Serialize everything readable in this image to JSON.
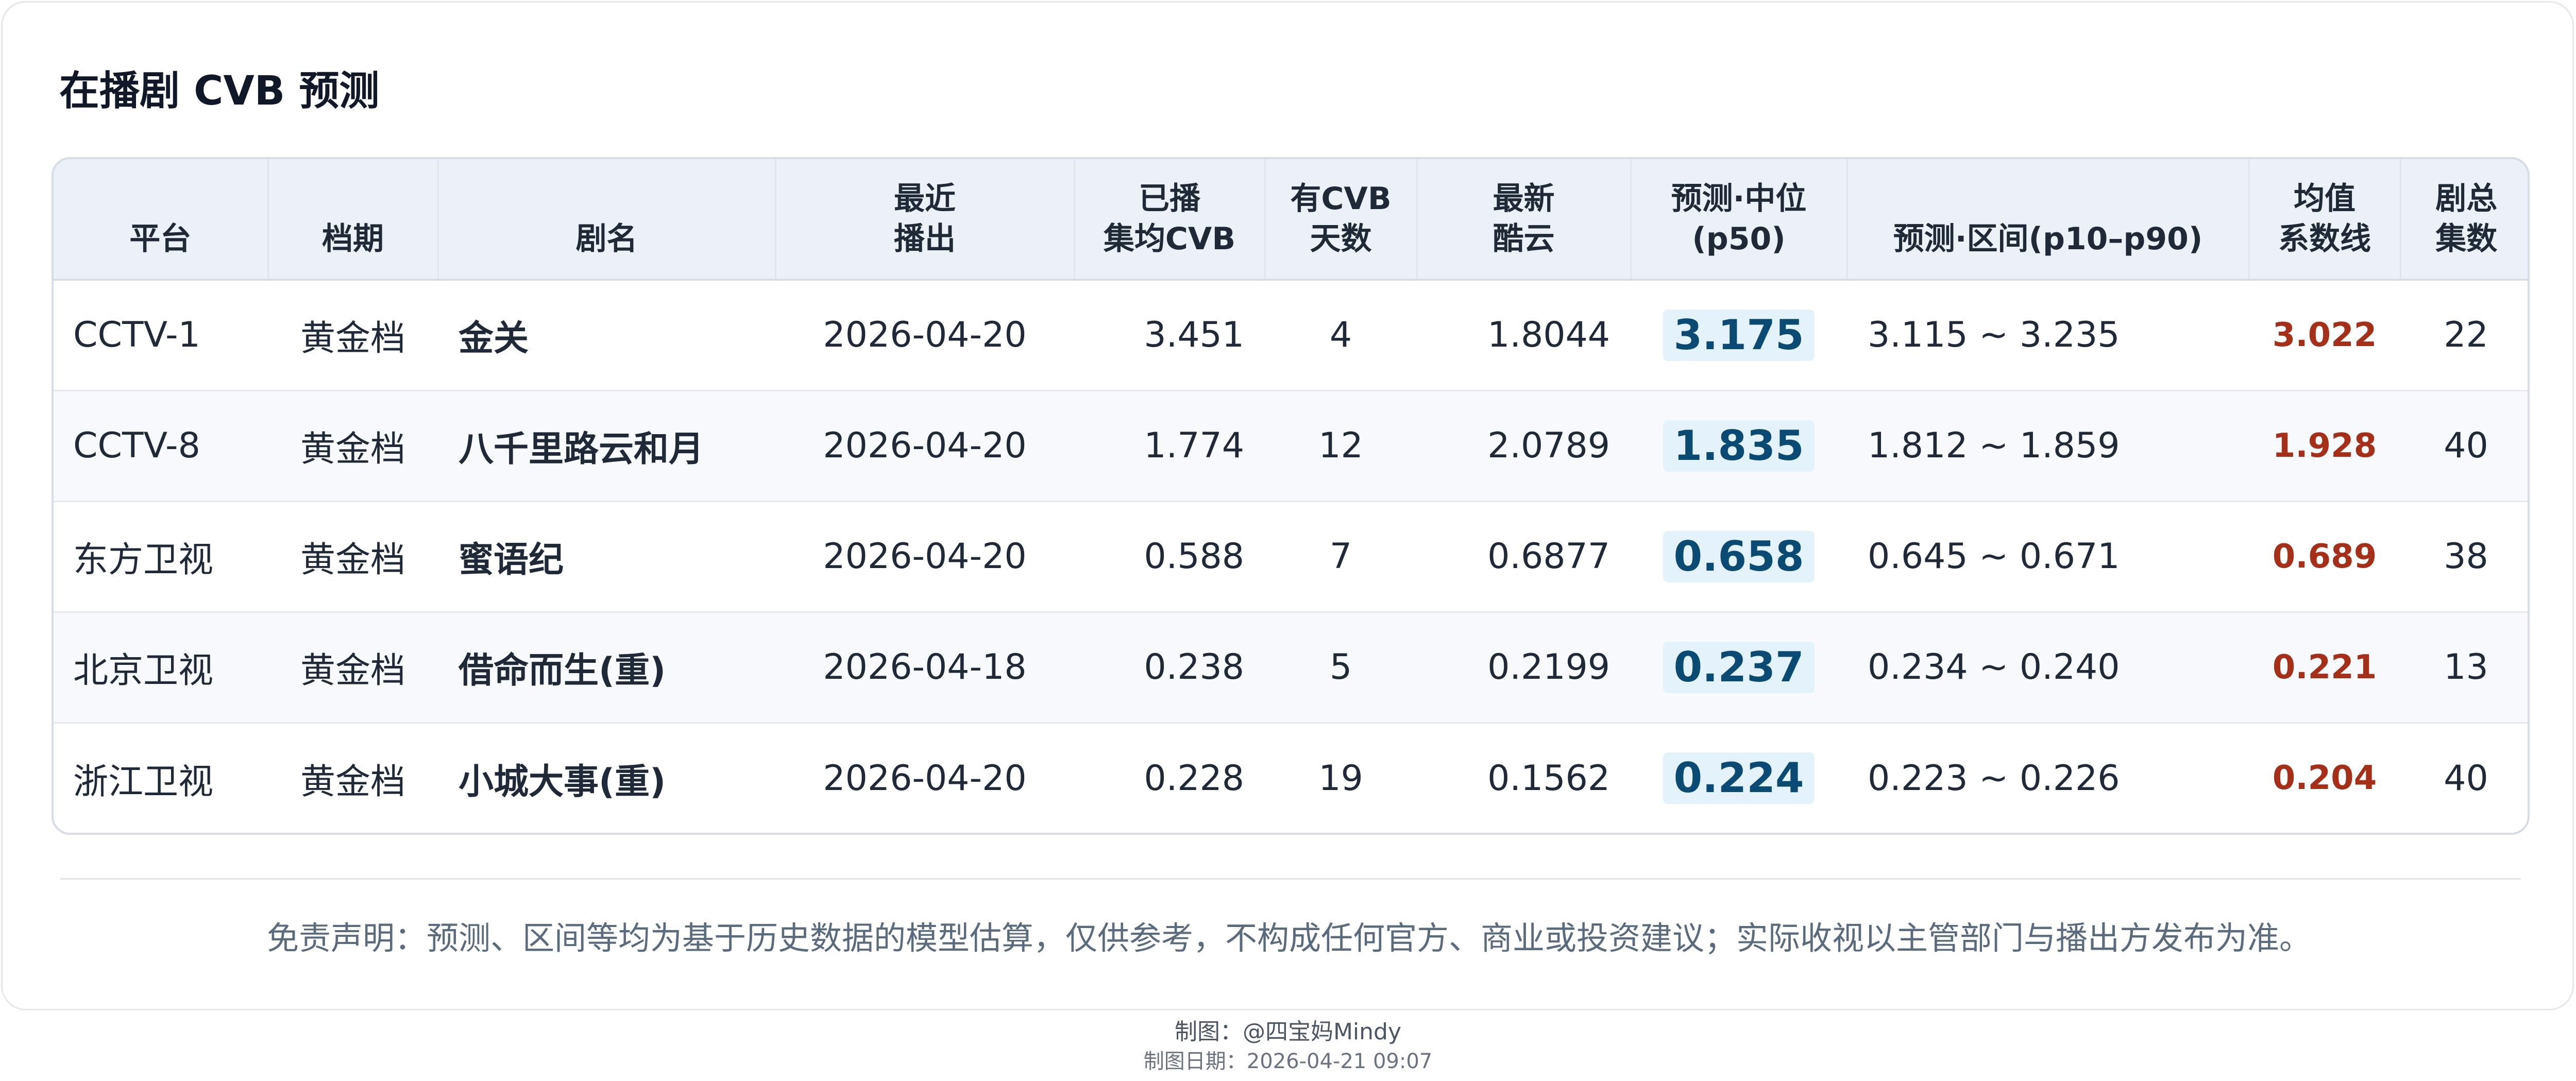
{
  "title": "在播剧 CVB 预测",
  "table": {
    "headers": {
      "platform": "平台",
      "slot": "档期",
      "name": "剧名",
      "latest_1": "最近",
      "latest_2": "播出",
      "avg_1": "已播",
      "avg_2": "集均CVB",
      "days_1": "有CVB",
      "days_2": "天数",
      "kuyun_1": "最新",
      "kuyun_2": "酷云",
      "pred_1": "预测·中位",
      "pred_2": "(p50)",
      "range": "预测·区间(p10–p90)",
      "mean_1": "均值",
      "mean_2": "系数线",
      "eps_1": "剧总",
      "eps_2": "集数"
    },
    "rows": [
      {
        "platform": "CCTV-1",
        "slot": "黄金档",
        "name": "金关",
        "date": "2026-04-20",
        "avg": "3.451",
        "days": "4",
        "kuyun": "1.8044",
        "pred": "3.175",
        "range": "3.115 ~ 3.235",
        "mean": "3.022",
        "eps": "22"
      },
      {
        "platform": "CCTV-8",
        "slot": "黄金档",
        "name": "八千里路云和月",
        "date": "2026-04-20",
        "avg": "1.774",
        "days": "12",
        "kuyun": "2.0789",
        "pred": "1.835",
        "range": "1.812 ~ 1.859",
        "mean": "1.928",
        "eps": "40"
      },
      {
        "platform": "东方卫视",
        "slot": "黄金档",
        "name": "蜜语纪",
        "date": "2026-04-20",
        "avg": "0.588",
        "days": "7",
        "kuyun": "0.6877",
        "pred": "0.658",
        "range": "0.645 ~ 0.671",
        "mean": "0.689",
        "eps": "38"
      },
      {
        "platform": "北京卫视",
        "slot": "黄金档",
        "name": "借命而生(重)",
        "date": "2026-04-18",
        "avg": "0.238",
        "days": "5",
        "kuyun": "0.2199",
        "pred": "0.237",
        "range": "0.234 ~ 0.240",
        "mean": "0.221",
        "eps": "13"
      },
      {
        "platform": "浙江卫视",
        "slot": "黄金档",
        "name": "小城大事(重)",
        "date": "2026-04-20",
        "avg": "0.228",
        "days": "19",
        "kuyun": "0.1562",
        "pred": "0.224",
        "range": "0.223 ~ 0.226",
        "mean": "0.204",
        "eps": "40"
      }
    ]
  },
  "disclaimer": "免责声明：预测、区间等均为基于历史数据的模型估算，仅供参考，不构成任何官方、商业或投资建议；实际收视以主管部门与播出方发布为准。",
  "credit": "制图：@四宝妈Mindy",
  "credit_date": "制图日期：2026-04-21 09:07",
  "colors": {
    "header_bg": "#ecf1f7",
    "pred_chip_bg": "#e3f2fb",
    "pred_text": "#0b4a72",
    "mean_text": "#a5301a"
  }
}
